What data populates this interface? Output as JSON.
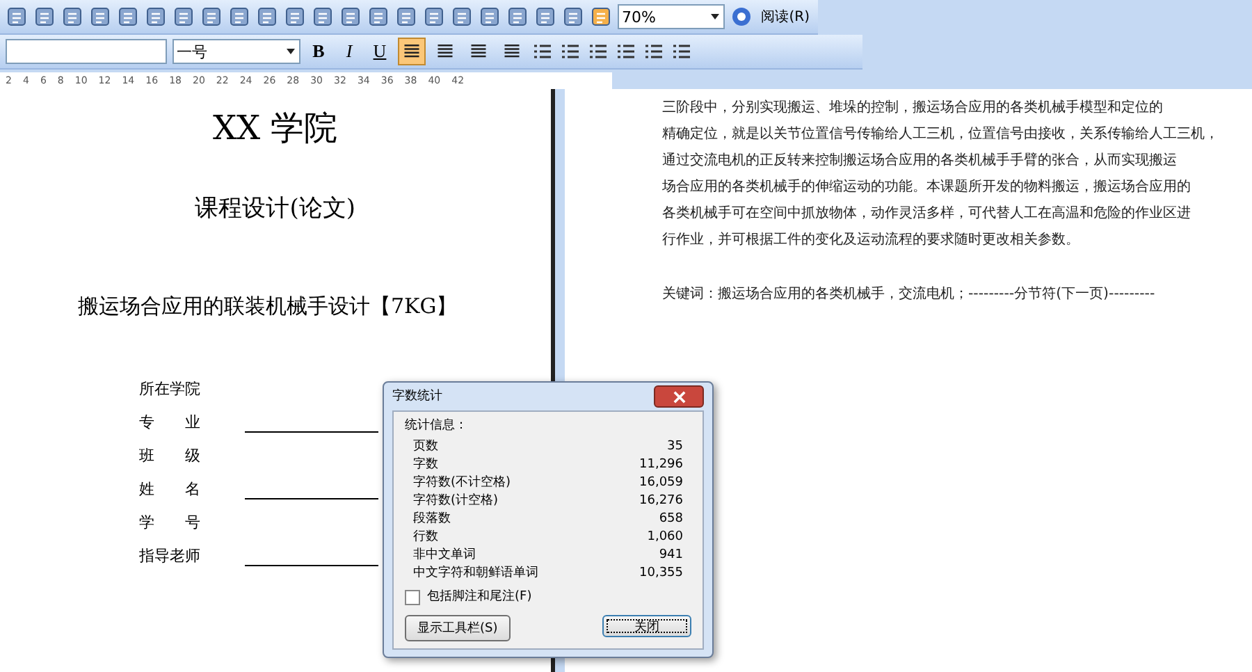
{
  "toolbar": {
    "zoom": "70%",
    "read_button": "阅读(R)"
  },
  "format_bar": {
    "font_size": "一号",
    "text_buttons": [
      {
        "label": "B",
        "kind": "bold"
      },
      {
        "label": "I",
        "kind": "italic"
      },
      {
        "label": "U",
        "kind": "underline"
      }
    ],
    "align": [
      {
        "selected": true
      },
      {
        "selected": false
      },
      {
        "selected": false
      },
      {
        "selected": false
      }
    ]
  },
  "ruler": {
    "marks": [
      "2",
      "4",
      "6",
      "8",
      "10",
      "12",
      "14",
      "16",
      "18",
      "20",
      "22",
      "24",
      "26",
      "28",
      "30",
      "32",
      "34",
      "36",
      "38",
      "40",
      "42"
    ]
  },
  "left_page": {
    "title": "XX 学院",
    "subtitle": "课程设计(论文)",
    "thesis_title": "搬运场合应用的联装机械手设计【7KG】",
    "form": [
      {
        "label": "所在学院",
        "underlined": false
      },
      {
        "label": "专　　业",
        "underlined": true
      },
      {
        "label": "班　　级",
        "underlined": false
      },
      {
        "label": "姓　　名",
        "underlined": true
      },
      {
        "label": "学　　号",
        "underlined": false
      },
      {
        "label": "指导老师",
        "underlined": true
      }
    ]
  },
  "right_page": {
    "paragraph": [
      "三阶段中，分别实现搬运、堆垛的控制，搬运场合应用的各类机械手模型和定位的",
      "精确定位，就是以关节位置信号传输给人工三机，位置信号由接收，关系传输给人工三机，",
      "通过交流电机的正反转来控制搬运场合应用的各类机械手手臂的张合，从而实现搬运",
      "场合应用的各类机械手的伸缩运动的功能。本课题所开发的物料搬运，搬运场合应用的",
      "各类机械手可在空间中抓放物体，动作灵活多样，可代替人工在高温和危险的作业区进",
      "行作业，并可根据工件的变化及运动流程的要求随时更改相关参数。"
    ],
    "keywords_label": "关键词：",
    "keywords": "搬运场合应用的各类机械手，交流电机；---------分节符(下一页)---------"
  },
  "dialog": {
    "title": "字数统计",
    "section": "统计信息：",
    "stats": [
      {
        "name": "页数",
        "value": "35"
      },
      {
        "name": "字数",
        "value": "11,296"
      },
      {
        "name": "字符数(不计空格)",
        "value": "16,059"
      },
      {
        "name": "字符数(计空格)",
        "value": "16,276"
      },
      {
        "name": "段落数",
        "value": "658"
      },
      {
        "name": "行数",
        "value": "1,060"
      },
      {
        "name": "非中文单词",
        "value": "941"
      },
      {
        "name": "中文字符和朝鲜语单词",
        "value": "10,355"
      }
    ],
    "footnotes": {
      "label": "包括脚注和尾注(F)",
      "checked": false
    },
    "buttons": [
      {
        "label": "显示工具栏(S)",
        "kind": "toolbar"
      },
      {
        "label": "关闭",
        "kind": "close"
      }
    ]
  }
}
